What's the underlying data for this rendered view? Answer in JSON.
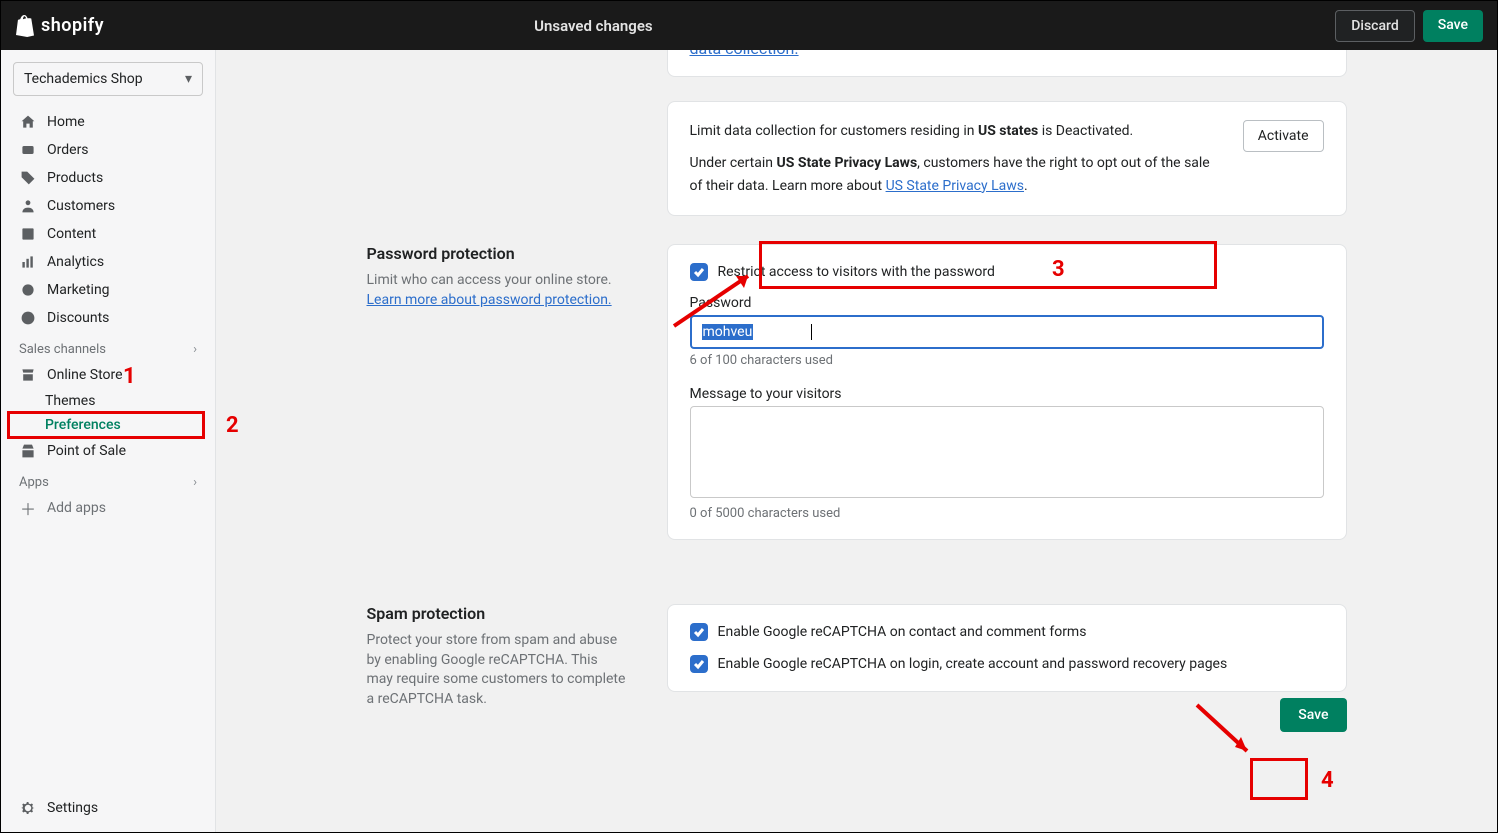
{
  "topbar": {
    "brand": "shopify",
    "unsaved": "Unsaved changes",
    "discard": "Discard",
    "save": "Save"
  },
  "sidebar": {
    "shop": "Techademics Shop",
    "items": [
      {
        "label": "Home"
      },
      {
        "label": "Orders"
      },
      {
        "label": "Products"
      },
      {
        "label": "Customers"
      },
      {
        "label": "Content"
      },
      {
        "label": "Analytics"
      },
      {
        "label": "Marketing"
      },
      {
        "label": "Discounts"
      }
    ],
    "sales_label": "Sales channels",
    "online_store": "Online Store",
    "themes": "Themes",
    "preferences": "Preferences",
    "pos": "Point of Sale",
    "apps_label": "Apps",
    "add_apps": "Add apps",
    "settings": "Settings"
  },
  "topcard": {
    "link": "data collection.",
    "line1_a": "Limit data collection for customers residing in ",
    "line1_b": "US states",
    "line1_c": " is Deactivated.",
    "line2_a": "Under certain ",
    "line2_b": "US State Privacy Laws",
    "line2_c": ", customers have the right to opt out of the sale of their data. Learn more about ",
    "line2_link": "US State Privacy Laws",
    "activate": "Activate"
  },
  "password": {
    "title": "Password protection",
    "desc": "Limit who can access your online store. ",
    "learn": "Learn more about password protection.",
    "restrict": "Restrict access to visitors with the password",
    "pw_label": "Password",
    "pw_value": "mohveu",
    "pw_counter": "6 of 100 characters used",
    "msg_label": "Message to your visitors",
    "msg_counter": "0 of 5000 characters used"
  },
  "spam": {
    "title": "Spam protection",
    "desc": "Protect your store from spam and abuse by enabling Google reCAPTCHA. This may require some customers to complete a reCAPTCHA task.",
    "chk1": "Enable Google reCAPTCHA on contact and comment forms",
    "chk2": "Enable Google reCAPTCHA on login, create account and password recovery pages"
  },
  "footer": {
    "save": "Save"
  },
  "annot": {
    "n1": "1",
    "n2": "2",
    "n3": "3",
    "n4": "4"
  }
}
